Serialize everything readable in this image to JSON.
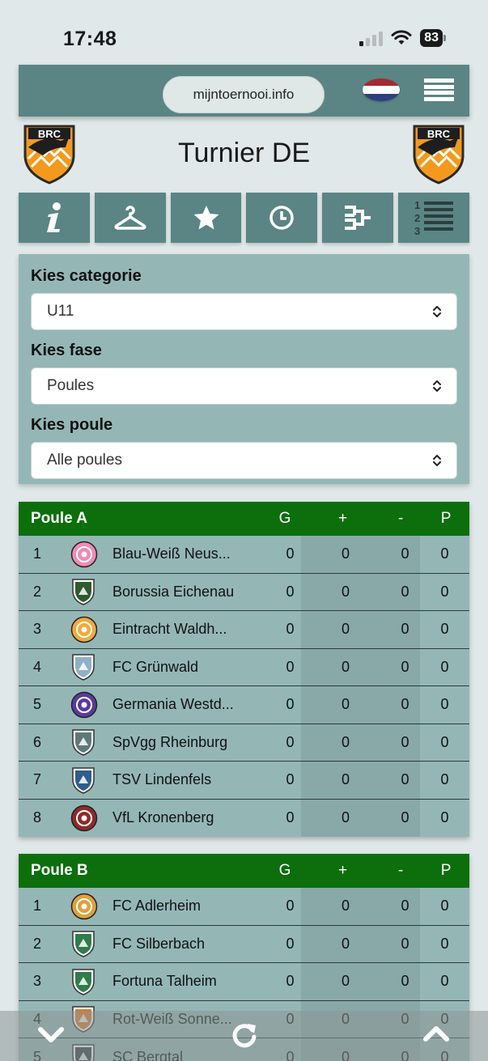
{
  "status_bar": {
    "time": "17:48",
    "battery": "83"
  },
  "top_bar": {
    "url": "mijntoernooi.info"
  },
  "header": {
    "title": "Turnier DE",
    "logo_text": "BRC"
  },
  "filters": [
    {
      "label": "Kies categorie",
      "value": "U11"
    },
    {
      "label": "Kies fase",
      "value": "Poules"
    },
    {
      "label": "Kies poule",
      "value": "Alle poules"
    }
  ],
  "columns": {
    "g": "G",
    "plus": "+",
    "minus": "-",
    "p": "P"
  },
  "poules": [
    {
      "name": "Poule A",
      "rows": [
        {
          "rank": "1",
          "team": "Blau-Weiß Neus...",
          "g": "0",
          "plus": "0",
          "minus": "0",
          "p": "0"
        },
        {
          "rank": "2",
          "team": "Borussia Eichenau",
          "g": "0",
          "plus": "0",
          "minus": "0",
          "p": "0"
        },
        {
          "rank": "3",
          "team": "Eintracht Waldh...",
          "g": "0",
          "plus": "0",
          "minus": "0",
          "p": "0"
        },
        {
          "rank": "4",
          "team": "FC Grünwald",
          "g": "0",
          "plus": "0",
          "minus": "0",
          "p": "0"
        },
        {
          "rank": "5",
          "team": "Germania Westd...",
          "g": "0",
          "plus": "0",
          "minus": "0",
          "p": "0"
        },
        {
          "rank": "6",
          "team": "SpVgg Rheinburg",
          "g": "0",
          "plus": "0",
          "minus": "0",
          "p": "0"
        },
        {
          "rank": "7",
          "team": "TSV Lindenfels",
          "g": "0",
          "plus": "0",
          "minus": "0",
          "p": "0"
        },
        {
          "rank": "8",
          "team": "VfL Kronenberg",
          "g": "0",
          "plus": "0",
          "minus": "0",
          "p": "0"
        }
      ]
    },
    {
      "name": "Poule B",
      "rows": [
        {
          "rank": "1",
          "team": "FC Adlerheim",
          "g": "0",
          "plus": "0",
          "minus": "0",
          "p": "0"
        },
        {
          "rank": "2",
          "team": "FC Silberbach",
          "g": "0",
          "plus": "0",
          "minus": "0",
          "p": "0"
        },
        {
          "rank": "3",
          "team": "Fortuna Talheim",
          "g": "0",
          "plus": "0",
          "minus": "0",
          "p": "0"
        },
        {
          "rank": "4",
          "team": "Rot-Weiß Sonne...",
          "g": "0",
          "plus": "0",
          "minus": "0",
          "p": "0"
        },
        {
          "rank": "5",
          "team": "SC Bergtal",
          "g": "0",
          "plus": "0",
          "minus": "0",
          "p": "0"
        }
      ]
    }
  ],
  "icons": {
    "nav": [
      "info-icon",
      "hanger-icon",
      "star-icon",
      "clock-icon",
      "bracket-icon",
      "ranking-list-icon"
    ],
    "bottom": [
      "chevron-down-icon",
      "refresh-icon",
      "chevron-up-icon"
    ]
  },
  "colors": {
    "accent": "#5a8584",
    "panel": "#94b7b6",
    "poule_header": "#0c6f0c",
    "brc_orange": "#f39a1e"
  }
}
